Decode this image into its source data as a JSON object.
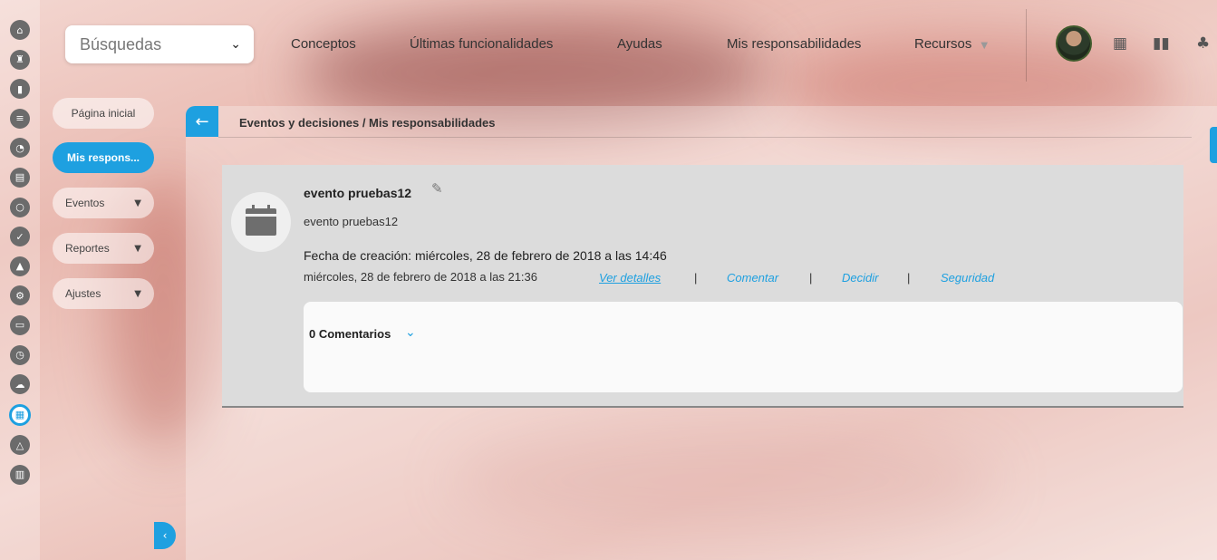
{
  "top": {
    "search": {
      "label": "Búsquedas",
      "chevron_icon": "chevron-down-icon"
    },
    "nav": [
      "Conceptos",
      "Últimas funcionalidades",
      "Ayudas",
      "Mis responsabilidades",
      "Recursos"
    ],
    "icons": [
      "calendar-icon",
      "books-icon",
      "bell-icon"
    ]
  },
  "rail": {
    "icons": [
      "home-icon",
      "chess-icon",
      "bar-chart-icon",
      "filter-icon",
      "pie-chart-icon",
      "document-icon",
      "cycle-icon",
      "check-icon",
      "warning-icon",
      "gears-icon",
      "presentation-icon",
      "clock-icon",
      "cloud-icon",
      "calendar-icon",
      "triangle-network-icon",
      "server-icon"
    ],
    "active": "calendar-icon"
  },
  "side": {
    "home": "Página inicial",
    "active": "Mis respons...",
    "events": "Eventos",
    "reports": "Reportes",
    "settings": "Ajustes"
  },
  "breadcrumb": "Eventos y decisiones / Mis responsabilidades",
  "event": {
    "title": "evento pruebas12",
    "description": "evento pruebas12",
    "created": "Fecha de creación: miércoles, 28 de febrero de 2018 a las 14:46",
    "date": "miércoles, 28 de febrero de 2018 a las 21:36",
    "actions": {
      "details": "Ver detalles",
      "comment": "Comentar",
      "decide": "Decidir",
      "security": "Seguridad"
    },
    "separator": "|"
  },
  "comments": {
    "label": "0 Comentarios"
  },
  "colors": {
    "accent": "#1ea0e0",
    "card": "#dcdcdc"
  }
}
